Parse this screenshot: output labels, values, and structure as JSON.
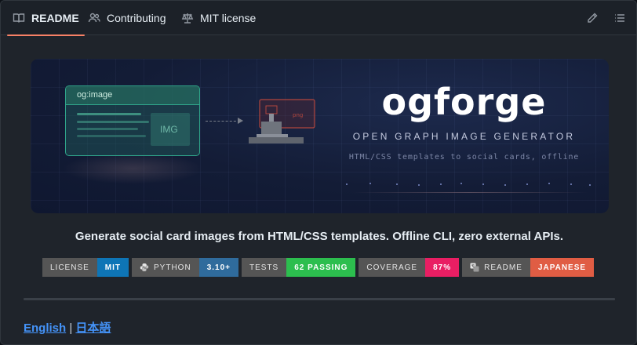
{
  "tabs": [
    {
      "label": "README",
      "icon": "book-icon",
      "active": true
    },
    {
      "label": "Contributing",
      "icon": "people-icon",
      "active": false
    },
    {
      "label": "MIT license",
      "icon": "law-icon",
      "active": false
    }
  ],
  "toolbar": {
    "edit_icon": "pencil-icon",
    "outline_icon": "list-icon"
  },
  "hero": {
    "card_label": "og:image",
    "card_img_label": "IMG",
    "machine_label": "png",
    "title": "ogforge",
    "subtitle": "OPEN GRAPH IMAGE GENERATOR",
    "description": "HTML/CSS templates to social cards, offline"
  },
  "tagline": "Generate social card images from HTML/CSS templates. Offline CLI, zero external APIs.",
  "badges": [
    {
      "key": "LICENSE",
      "value": "MIT",
      "color": "#0e75b6"
    },
    {
      "key": "PYTHON",
      "value": "3.10+",
      "color": "#2f6b9c",
      "icon": "python-icon"
    },
    {
      "key": "TESTS",
      "value": "62 PASSING",
      "color": "#2cbe4e"
    },
    {
      "key": "COVERAGE",
      "value": "87%",
      "color": "#e91e63"
    },
    {
      "key": "README",
      "value": "JAPANESE",
      "color": "#e05d44",
      "icon": "translate-icon"
    }
  ],
  "languages": {
    "english": "English",
    "separator": " | ",
    "japanese": "日本語"
  },
  "colors": {
    "accent_tab": "#f78166",
    "link": "#4493f8",
    "background": "#1f242b"
  }
}
